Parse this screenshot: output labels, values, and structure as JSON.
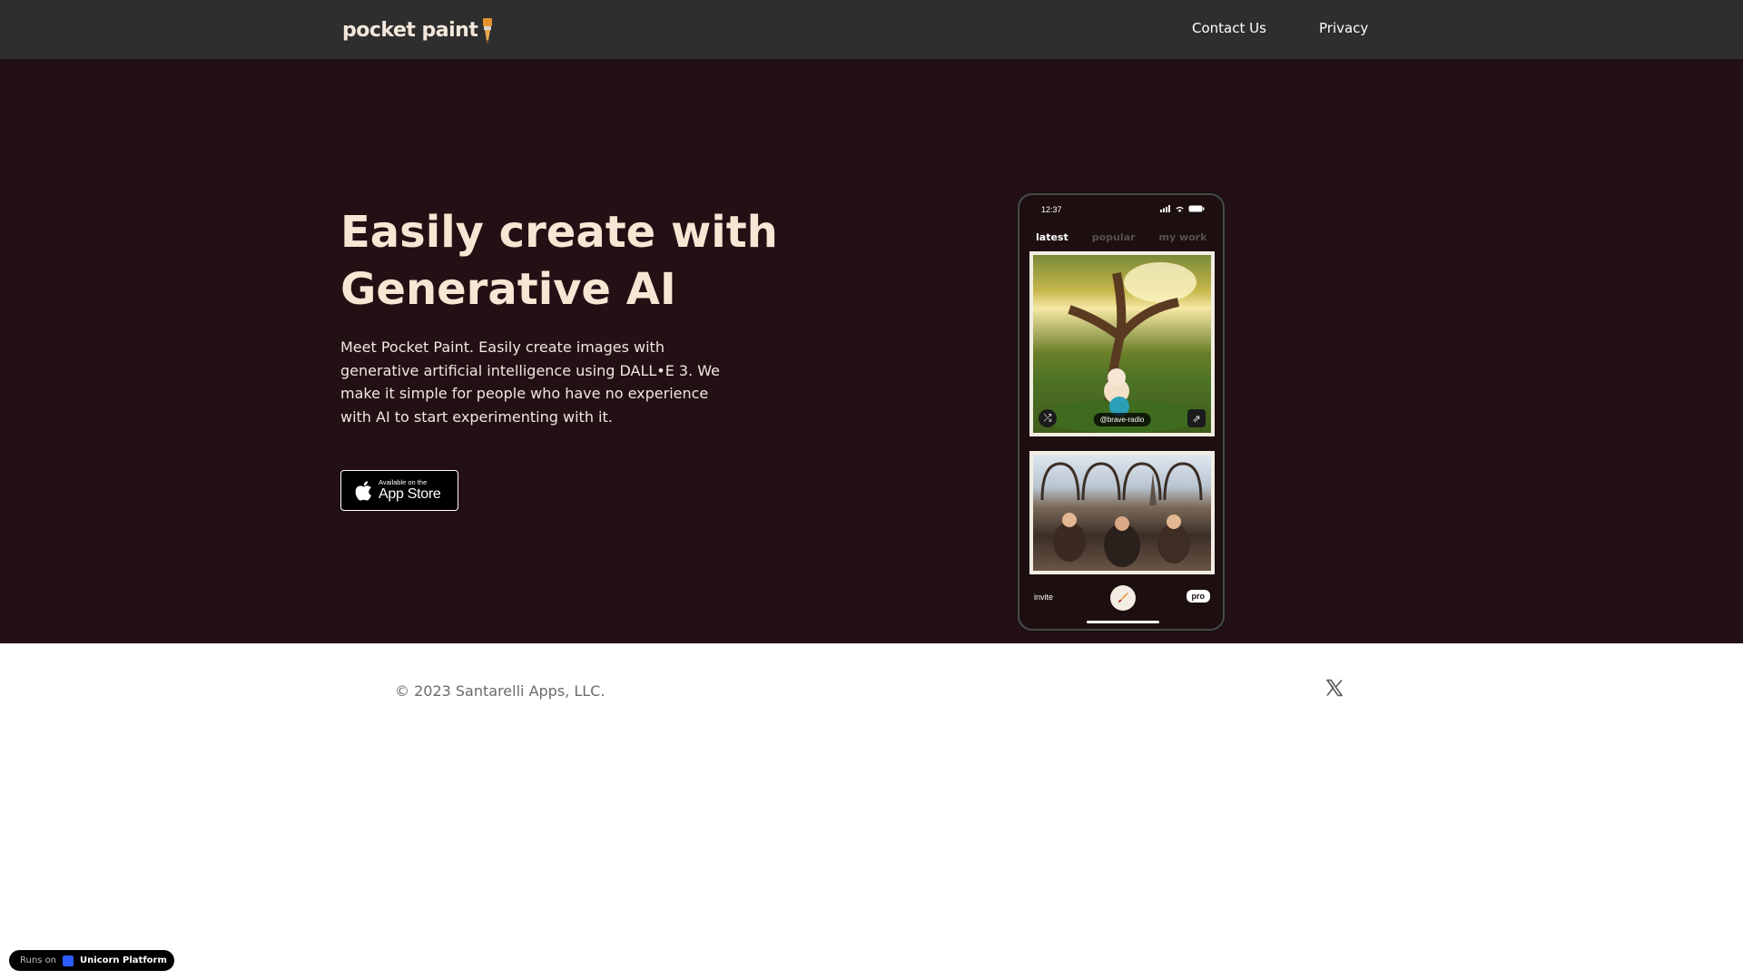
{
  "header": {
    "logo_text": "pocket paint",
    "nav": {
      "contact": "Contact Us",
      "privacy": "Privacy"
    }
  },
  "hero": {
    "headline_line1": "Easily create with",
    "headline_line2": "Generative AI",
    "description": "Meet Pocket Paint. Easily create images with generative artificial intelligence using DALL•E 3. We make it simple for people who have no experience with AI to start experimenting with it.",
    "appstore": {
      "small": "Available on the",
      "big": "App Store"
    }
  },
  "phone": {
    "time": "12:37",
    "tabs": [
      "latest",
      "popular",
      "my work"
    ],
    "card1_handle": "@brave-radio",
    "invite": "invite",
    "pro": "pro"
  },
  "footer": {
    "copyright": "© 2023 Santarelli Apps, LLC."
  },
  "badge": {
    "small": "Runs on",
    "big": "Unicorn Platform"
  },
  "colors": {
    "topbar": "#2e2e2e",
    "hero_bg": "#231014",
    "headline": "#f8e6d4",
    "accent_brush": "#e8912f"
  },
  "icons": {
    "logo": "paintbrush-icon",
    "appstore": "apple-icon",
    "social": "x-icon",
    "shuffle": "shuffle-icon",
    "share": "share-icon",
    "paint": "paintbrush-icon"
  }
}
